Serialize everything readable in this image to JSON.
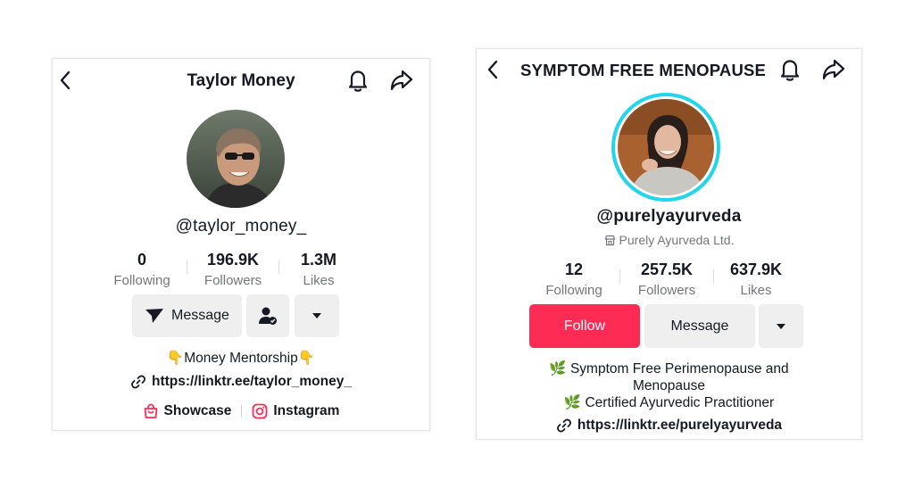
{
  "profile_left": {
    "title": "Taylor Money",
    "username": "@taylor_money_",
    "stats": [
      {
        "value": "0",
        "label": "Following"
      },
      {
        "value": "196.9K",
        "label": "Followers"
      },
      {
        "value": "1.3M",
        "label": "Likes"
      }
    ],
    "buttons": {
      "message": "Message"
    },
    "bio_line": "Money Mentorship",
    "bio_emoji": "👇",
    "link": "https://linktr.ee/taylor_money_",
    "showcase": "Showcase",
    "instagram": "Instagram",
    "colors": {
      "showcase_icon": "#fe2c55",
      "instagram_icon": "#fe2c55"
    }
  },
  "profile_right": {
    "title": "SYMPTOM FREE MENOPAUSE",
    "username": "@purelyayurveda",
    "business_name": "Purely Ayurveda Ltd.",
    "stats": [
      {
        "value": "12",
        "label": "Following"
      },
      {
        "value": "257.5K",
        "label": "Followers"
      },
      {
        "value": "637.9K",
        "label": "Likes"
      }
    ],
    "buttons": {
      "follow": "Follow",
      "message": "Message"
    },
    "bio_lines": [
      "🌿 Symptom Free Perimenopause and",
      "Menopause",
      "🌿 Certified Ayurvedic Practitioner"
    ],
    "link": "https://linktr.ee/purelyayurveda",
    "colors": {
      "follow_button": "#fe2c55",
      "story_ring": "#20d5ec"
    }
  }
}
